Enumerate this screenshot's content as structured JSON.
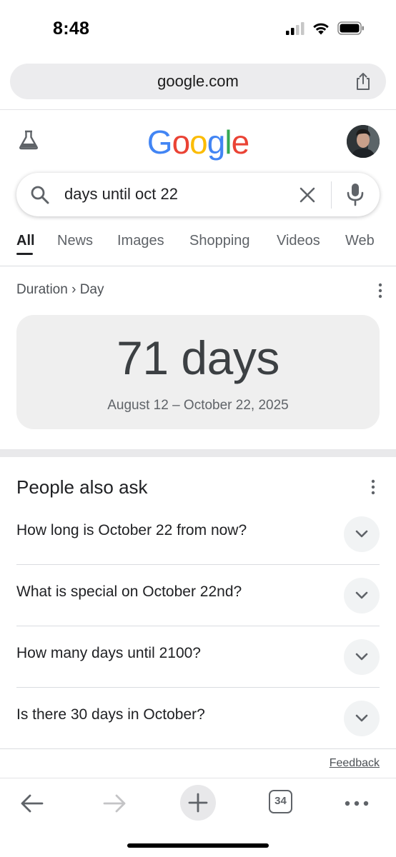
{
  "status_bar": {
    "time": "8:48",
    "icons": [
      "cellular-signal-icon",
      "wifi-icon",
      "battery-icon"
    ]
  },
  "url_bar": {
    "url": "google.com",
    "share_icon": "share-icon"
  },
  "header": {
    "labs_icon": "flask-icon",
    "logo_letters": [
      {
        "char": "G",
        "color": "#4285F4"
      },
      {
        "char": "o",
        "color": "#EA4335"
      },
      {
        "char": "o",
        "color": "#FBBC05"
      },
      {
        "char": "g",
        "color": "#4285F4"
      },
      {
        "char": "l",
        "color": "#34A853"
      },
      {
        "char": "e",
        "color": "#EA4335"
      }
    ],
    "avatar": "profile-avatar"
  },
  "search": {
    "query": "days until oct 22"
  },
  "tabs": [
    {
      "label": "All",
      "active": true
    },
    {
      "label": "News",
      "active": false
    },
    {
      "label": "Images",
      "active": false
    },
    {
      "label": "Shopping",
      "active": false
    },
    {
      "label": "Videos",
      "active": false
    },
    {
      "label": "Web",
      "active": false
    }
  ],
  "result": {
    "breadcrumb": "Duration › Day",
    "value": "71 days",
    "range": "August 12 – October 22, 2025"
  },
  "people_also_ask": {
    "title": "People also ask",
    "questions": [
      "How long is October 22 from now?",
      "What is special on October 22nd?",
      "How many days until 2100?",
      "Is there 30 days in October?"
    ]
  },
  "feedback": "Feedback",
  "toolbar": {
    "tab_count": "34",
    "buttons": [
      "back-icon",
      "forward-icon",
      "new-tab-icon",
      "tabs-icon",
      "more-icon"
    ]
  }
}
